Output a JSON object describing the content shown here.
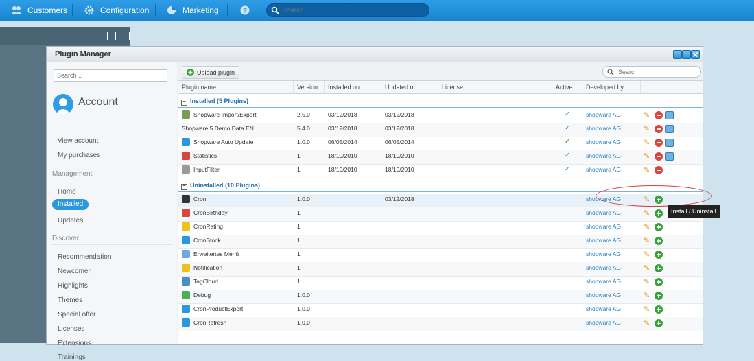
{
  "topbar": {
    "items": [
      {
        "label": "Customers",
        "icon": "users-icon"
      },
      {
        "label": "Configuration",
        "icon": "gear-icon"
      },
      {
        "label": "Marketing",
        "icon": "pie-chart-icon"
      },
      {
        "label": "",
        "icon": "help-icon"
      }
    ],
    "search_placeholder": "Search..."
  },
  "window": {
    "title": "Plugin Manager"
  },
  "nav": {
    "search_placeholder": "Search ..",
    "account_title": "Account",
    "account_items": [
      "View account",
      "My purchases"
    ],
    "management_heading": "Management",
    "management_items": [
      "Home",
      "Installed",
      "Updates"
    ],
    "active_item": "Installed",
    "discover_heading": "Discover",
    "discover_items": [
      "Recommendation",
      "Newcomer",
      "Highlights",
      "Themes",
      "Special offer",
      "Licenses",
      "Extensions",
      "Trainings"
    ]
  },
  "toolbar": {
    "upload_label": "Upload plugin",
    "search_placeholder": "Search"
  },
  "columns": [
    "Plugin name",
    "Version",
    "Installed on",
    "Updated on",
    "License",
    "Active",
    "Developed by"
  ],
  "groups": [
    {
      "title": "Installed (5 Plugins)",
      "rows": [
        {
          "name": "Shopware Import/Export",
          "version": "2.5.0",
          "installed": "03/12/2018",
          "updated": "03/12/2018",
          "active": "✓",
          "dev": "shopware AG",
          "icon": "import-export-icon",
          "color": "#7a9a5a",
          "actions": [
            "edit",
            "delete",
            "config"
          ]
        },
        {
          "name": "Shopware 5 Demo Data EN",
          "version": "5.4.0",
          "installed": "03/12/2018",
          "updated": "03/12/2018",
          "active": "✓",
          "dev": "shopware AG",
          "icon": "",
          "color": "",
          "actions": [
            "edit",
            "delete",
            "config"
          ]
        },
        {
          "name": "Shopware Auto Update",
          "version": "1.0.0",
          "installed": "06/05/2014",
          "updated": "06/05/2014",
          "active": "✓",
          "dev": "shopware AG",
          "icon": "refresh-icon",
          "color": "#2b97dd",
          "actions": [
            "edit",
            "delete",
            "config"
          ]
        },
        {
          "name": "Statistics",
          "version": "1",
          "installed": "18/10/2010",
          "updated": "18/10/2010",
          "active": "✓",
          "dev": "shopware AG",
          "icon": "pie-chart-icon",
          "color": "#d9463e",
          "actions": [
            "edit",
            "delete",
            "config"
          ]
        },
        {
          "name": "InputFilter",
          "version": "1",
          "installed": "18/10/2010",
          "updated": "18/10/2010",
          "active": "✓",
          "dev": "shopware AG",
          "icon": "filter-icon",
          "color": "#9a9a9a",
          "actions": [
            "edit",
            "delete"
          ]
        }
      ]
    },
    {
      "title": "Uninstalled (10 Plugins)",
      "rows": [
        {
          "name": "Cron",
          "version": "1.0.0",
          "installed": "",
          "updated": "03/12/2018",
          "active": "",
          "dev": "shopware AG",
          "icon": "terminal-icon",
          "color": "#333333",
          "actions": [
            "edit",
            "add"
          ]
        },
        {
          "name": "CronBirthday",
          "version": "1",
          "installed": "",
          "updated": "",
          "active": "",
          "dev": "shopware AG",
          "icon": "gift-icon",
          "color": "#d9463e",
          "actions": [
            "edit",
            "add"
          ]
        },
        {
          "name": "CronRating",
          "version": "1",
          "installed": "",
          "updated": "",
          "active": "",
          "dev": "shopware AG",
          "icon": "star-icon",
          "color": "#f0c020",
          "actions": [
            "edit",
            "add"
          ]
        },
        {
          "name": "CronStock",
          "version": "1",
          "installed": "",
          "updated": "",
          "active": "",
          "dev": "shopware AG",
          "icon": "stock-chart-icon",
          "color": "#2b97dd",
          "actions": [
            "edit",
            "add"
          ]
        },
        {
          "name": "Erweitertes Menü",
          "version": "1",
          "installed": "",
          "updated": "",
          "active": "",
          "dev": "shopware AG",
          "icon": "menu-icon",
          "color": "#6fa8dc",
          "actions": [
            "edit",
            "add"
          ]
        },
        {
          "name": "Notification",
          "version": "1",
          "installed": "",
          "updated": "",
          "active": "",
          "dev": "shopware AG",
          "icon": "notification-icon",
          "color": "#f0c020",
          "actions": [
            "edit",
            "add"
          ]
        },
        {
          "name": "TagCloud",
          "version": "1",
          "installed": "",
          "updated": "",
          "active": "",
          "dev": "shopware AG",
          "icon": "cloud-icon",
          "color": "#4a8fc2",
          "actions": [
            "edit",
            "add"
          ]
        },
        {
          "name": "Debug",
          "version": "1.0.0",
          "installed": "",
          "updated": "",
          "active": "",
          "dev": "shopware AG",
          "icon": "bug-icon",
          "color": "#4caf50",
          "actions": [
            "edit",
            "add"
          ]
        },
        {
          "name": "CronProductExport",
          "version": "1.0.0",
          "installed": "",
          "updated": "",
          "active": "",
          "dev": "shopware AG",
          "icon": "export-icon",
          "color": "#2b97dd",
          "actions": [
            "edit",
            "add"
          ]
        },
        {
          "name": "CronRefresh",
          "version": "1.0.0",
          "installed": "",
          "updated": "",
          "active": "",
          "dev": "shopware AG",
          "icon": "clock-icon",
          "color": "#2b97dd",
          "actions": [
            "edit",
            "add"
          ]
        }
      ]
    }
  ],
  "tooltip": "Install / Uninstall"
}
